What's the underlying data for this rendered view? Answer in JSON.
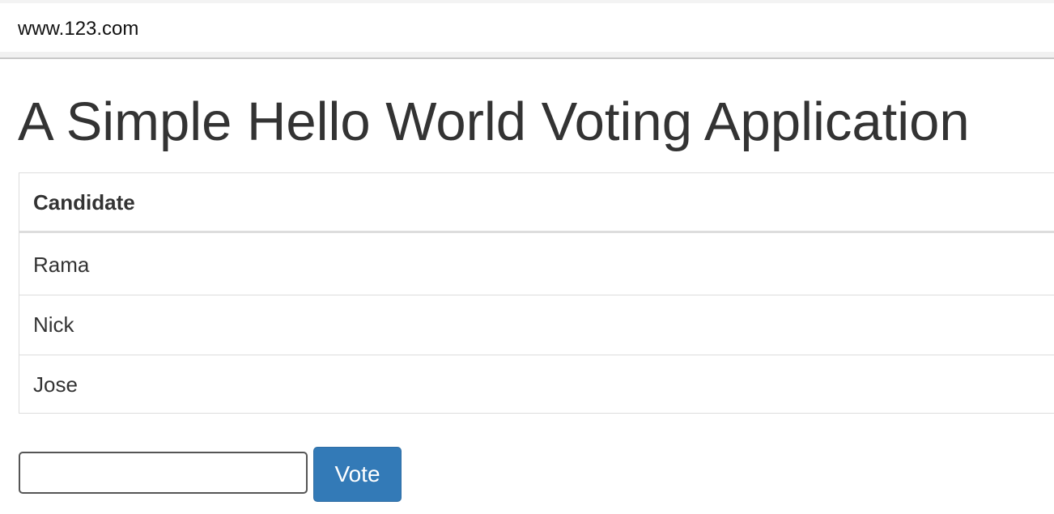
{
  "browser": {
    "address": "www.123.com"
  },
  "page": {
    "title": "A Simple Hello World Voting Application"
  },
  "table": {
    "header": "Candidate",
    "rows": [
      "Rama",
      "Nick",
      "Jose"
    ]
  },
  "form": {
    "input_value": "",
    "input_placeholder": "",
    "vote_label": "Vote",
    "vote_button_color": "#337ab7"
  }
}
